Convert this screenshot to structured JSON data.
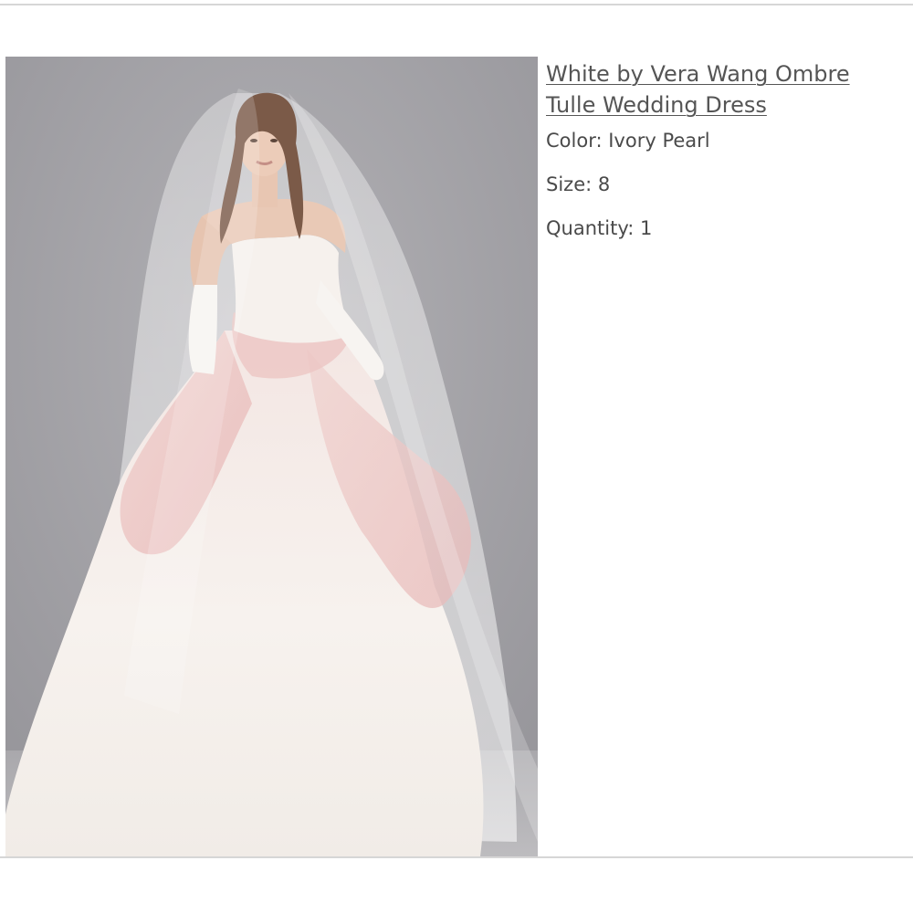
{
  "product": {
    "title": "White by Vera Wang Ombre Tulle Wedding Dress",
    "image_alt": "Model wearing a strapless ivory ball gown with blush ombre tulle, long veil and opera gloves"
  },
  "attributes": {
    "color": {
      "label": "Color:",
      "value": "Ivory Pearl"
    },
    "size": {
      "label": "Size:",
      "value": "8"
    },
    "quantity": {
      "label": "Quantity:",
      "value": "1"
    }
  },
  "colors": {
    "backdrop": "#a3a2a7",
    "gown_ivory": "#f4efea",
    "gown_blush": "#ecc3c3",
    "text": "#4a4a4a"
  }
}
